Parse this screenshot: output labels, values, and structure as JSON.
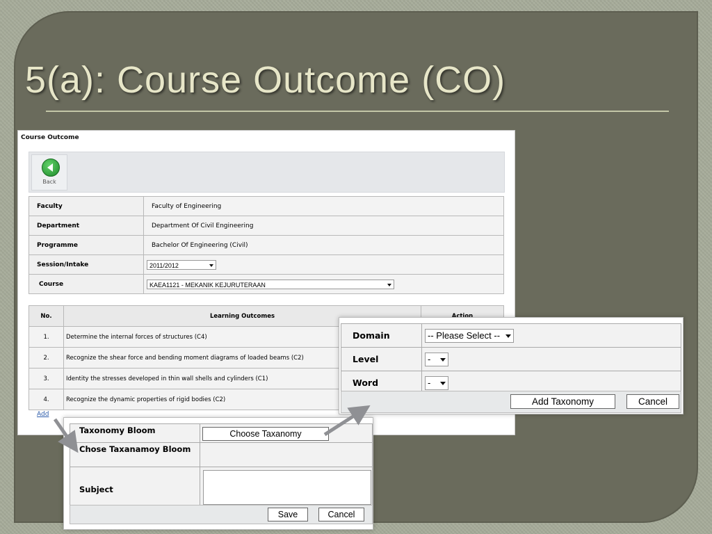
{
  "slide": {
    "title": "5(a): Course Outcome (CO)"
  },
  "panel": {
    "header": "Course Outcome",
    "back_label": "Back",
    "fields": [
      {
        "label": "Faculty",
        "value": "Faculty of Engineering"
      },
      {
        "label": "Department",
        "value": "Department Of Civil Engineering"
      },
      {
        "label": "Programme",
        "value": "Bachelor Of Engineering (Civil)"
      },
      {
        "label": "Session/Intake",
        "value": "2011/2012"
      },
      {
        "label": "Course",
        "value": "KAEA1121 - MEKANIK KEJURUTERAAN"
      }
    ],
    "outcomes_table": {
      "headers": [
        "No.",
        "Learning Outcomes",
        "Action"
      ],
      "rows": [
        {
          "no": "1.",
          "text": "Determine the internal forces of structures (C4)"
        },
        {
          "no": "2.",
          "text": "Recognize the shear force and bending moment diagrams of loaded beams (C2)"
        },
        {
          "no": "3.",
          "text": "Identity the stresses developed in thin wall shells and cylinders (C1)"
        },
        {
          "no": "4.",
          "text": "Recognize the dynamic properties of rigid bodies (C2)"
        }
      ]
    },
    "add_link": "Add"
  },
  "taxonomy_popup": {
    "rows": [
      {
        "label": "Domain",
        "value": "-- Please Select --"
      },
      {
        "label": "Level",
        "value": "-"
      },
      {
        "label": "Word",
        "value": "-"
      }
    ],
    "add_button": "Add Taxonomy",
    "cancel_button": "Cancel"
  },
  "outcome_popup": {
    "taxonomy_label": "Taxonomy Bloom",
    "choose_button": "Choose Taxanomy",
    "chosen_label": "Chose Taxanamoy Bloom",
    "subject_label": "Subject",
    "save_button": "Save",
    "cancel_button": "Cancel"
  },
  "colors": {
    "slide_bg": "#6a6b5c",
    "title": "#e7e6c8",
    "link": "#2b5aa9",
    "arrow": "#8f9094"
  }
}
